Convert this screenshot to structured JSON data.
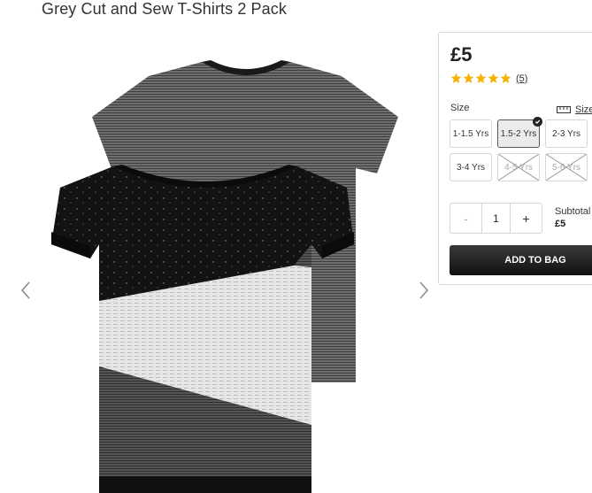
{
  "product": {
    "title": "Grey Cut and Sew T-Shirts 2 Pack",
    "price": "£5",
    "rating": {
      "stars": 5,
      "review_count": "(5)"
    }
  },
  "size": {
    "label": "Size",
    "guide_label": "Size",
    "options": [
      {
        "label": "1-1.5 Yrs",
        "state": "available"
      },
      {
        "label": "1.5-2 Yrs",
        "state": "selected"
      },
      {
        "label": "2-3 Yrs",
        "state": "available"
      },
      {
        "label": "3-4 Yrs",
        "state": "available"
      },
      {
        "label": "4-5 Yrs",
        "state": "unavailable"
      },
      {
        "label": "5-6 Yrs",
        "state": "unavailable"
      }
    ]
  },
  "quantity": {
    "minus": "-",
    "value": "1",
    "plus": "+"
  },
  "subtotal": {
    "label": "Subtotal",
    "value": "£5"
  },
  "cta": {
    "add_to_bag": "ADD TO BAG"
  },
  "colors": {
    "star": "#f5b200",
    "button_dark": "#1a1a1a",
    "border": "#d6d6d6"
  }
}
